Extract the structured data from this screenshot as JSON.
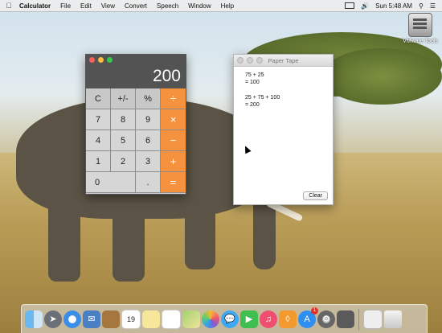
{
  "menubar": {
    "apple_icon": "apple-icon",
    "app_name": "Calculator",
    "menus": [
      "File",
      "Edit",
      "View",
      "Convert",
      "Speech",
      "Window",
      "Help"
    ],
    "clock": "Sun 5:48 AM"
  },
  "desktop": {
    "vmware_label": "VMware Tools"
  },
  "calculator": {
    "display": "200",
    "keys": {
      "row1": [
        "C",
        "+/-",
        "%",
        "÷"
      ],
      "row2": [
        "7",
        "8",
        "9",
        "×"
      ],
      "row3": [
        "4",
        "5",
        "6",
        "−"
      ],
      "row4": [
        "1",
        "2",
        "3",
        "+"
      ],
      "row5": [
        "0",
        ".",
        "="
      ]
    }
  },
  "paper_tape": {
    "title": "Paper Tape",
    "line1": "75 + 25",
    "line2": "= 100",
    "line3": "25 + 75 + 100",
    "line4": "= 200",
    "clear_label": "Clear"
  },
  "dock": {
    "calendar_date": "19",
    "appstore_badge": "1"
  },
  "colors": {
    "operator": "#f5923e",
    "display_bg": "#535353"
  }
}
